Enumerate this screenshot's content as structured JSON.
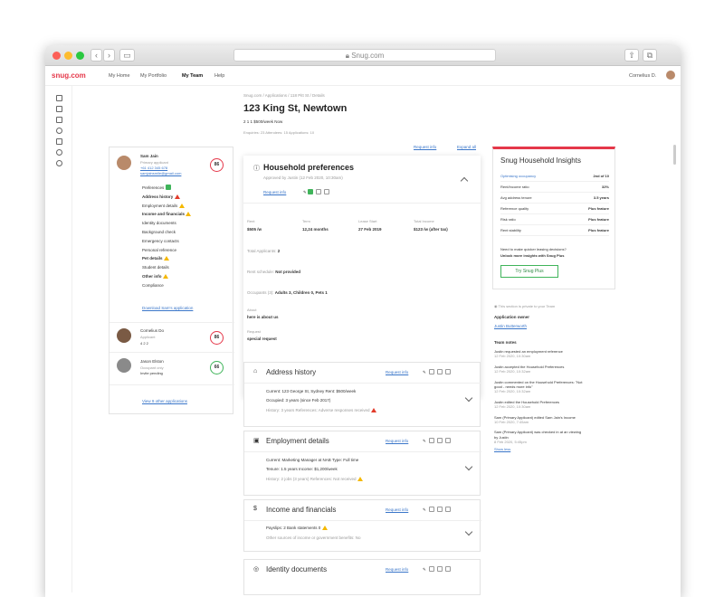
{
  "browser": {
    "url": "Snug.com"
  },
  "nav": {
    "logo": "snug.com",
    "items": [
      "My Home",
      "My Portfolio",
      "My Team",
      "Help"
    ],
    "user": "Cornelius D."
  },
  "page": {
    "breadcrumb": "Snug.com / Applications / 118 Pitt St / Details",
    "title": "123 King St, Newtown",
    "features": "2  1  1  $500/week  Now",
    "stats": "Enquiries: 23   Attendees: 15   Applications: 10"
  },
  "applicants": [
    {
      "name": "Sam Jain",
      "role": "Primary applicant",
      "phone": "+61 412 345 678",
      "email": "samjainsmile@gmail.com",
      "score": "86"
    },
    {
      "name": "Cornelius Do",
      "role": "Applicant",
      "counts": "4  2  2",
      "score": "86"
    },
    {
      "name": "Jason Elston",
      "role": "Occupant only",
      "status": "Invite pending",
      "score": "66"
    }
  ],
  "checklist": [
    "Preferences",
    "Address history",
    "Employment details",
    "Income and financials",
    "Identity documents",
    "Background check",
    "Emergency contacts",
    "Personal reference",
    "Pet details",
    "Student details",
    "Other info",
    "Compliance"
  ],
  "download": "Download Sam's application",
  "view_other": "View 9 other applications",
  "top_links": {
    "request": "Request info",
    "expand": "Expand all"
  },
  "prefs": {
    "title": "Household preferences",
    "approved": "Approved by Justin (12 Feb 2020, 10:30am)",
    "request": "Request info",
    "rent_l": "Rent",
    "rent_v": "$505 /w",
    "term_l": "Term",
    "term_v": "12,24 months",
    "lease_l": "Lease Start",
    "lease_v": "27 Feb 2019",
    "income_l": "Total Income",
    "income_v": "$123 /w (after tax)",
    "applicants": "Total Applicants:",
    "applicants_v": "2",
    "sched": "Rent schedule:",
    "sched_v": "Not provided",
    "occ": "Occupants (3):",
    "occ_v": "Adults 3, Children 0, Pets 1",
    "about_l": "About",
    "about_v": "here is about us",
    "req_l": "Request",
    "req_v": "special request"
  },
  "sections": [
    {
      "title": "Address history",
      "l1": "Current: 123 George St, Sydney    Rent: $500/week",
      "l2": "Occupied: 3 years (since Feb 2017)",
      "l3": "History: 3 years          References: Adverse responses received"
    },
    {
      "title": "Employment details",
      "l1": "Current: Marketing Manager at NAB    Type: Full time",
      "l2": "Tenure: 1.5 years    Income: $1,200/week",
      "l3": "History: 2 jobs (3 years)    References: Not received"
    },
    {
      "title": "Income and financials",
      "l1": "Payslips: 2    Bank statements 0",
      "l2": "Other sources of income or government benefits: No",
      "l3": ""
    },
    {
      "title": "Identity documents",
      "l1": "",
      "l2": "",
      "l3": ""
    }
  ],
  "insights": {
    "title": "Snug Household Insights",
    "rows": [
      [
        "Optimising occupancy",
        "2nd of 10"
      ],
      [
        "Rent/Income ratio",
        "32%"
      ],
      [
        "Avg address tenure",
        "3.5 years"
      ],
      [
        "Reference quality",
        "Plus feature"
      ],
      [
        "Risk ratio",
        "Plus feature"
      ],
      [
        "Rent stability",
        "Plus feature"
      ]
    ],
    "cta1": "Need to make quicker leasing decisions?",
    "cta2": "Unlock more insights with Snug Plus",
    "button": "Try Snug Plus"
  },
  "team": {
    "private": "This section is private to your Team",
    "owner_l": "Application owner",
    "owner": "Justin Butterworth",
    "notes_l": "Team notes",
    "notes": [
      {
        "t": "Justin requested an employment reference",
        "d": "12 Feb 2020, 10:30am"
      },
      {
        "t": "Justin accepted the Household Preferences",
        "d": "12 Feb 2020, 10:32am"
      },
      {
        "t": "Justin commented on the Household Preferences: \"Not good - needs more info\"",
        "d": "12 Feb 2020, 10:32am"
      },
      {
        "t": "Justin edited the Household Preferences",
        "d": "12 Feb 2020, 10:30am"
      },
      {
        "t": "Sam (Primary Applicant) edited Sam Jain's Income",
        "d": "10 Feb 2020, 7:45am"
      },
      {
        "t": "Sam (Primary Applicant) was checked in at an viewing by Justin",
        "d": "8 Feb 2020, 5:45pm"
      }
    ],
    "show_less": "Show less"
  }
}
